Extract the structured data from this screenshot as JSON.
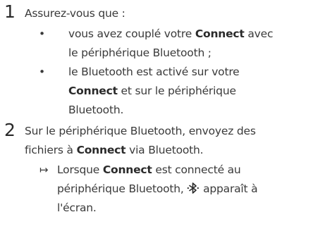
{
  "step1": {
    "number": "1",
    "intro": "Assurez-vous que :",
    "bullet_symbol": "•",
    "bullets": [
      {
        "line1_a": "vous avez couplé votre ",
        "line1_b": "Connect",
        "line1_c": " avec",
        "line2": "le périphérique Bluetooth ;"
      },
      {
        "line1": "le Bluetooth est activé sur votre",
        "line2_a": "Connect",
        "line2_b": " et sur le périphérique",
        "line3": "Bluetooth."
      }
    ]
  },
  "step2": {
    "number": "2",
    "line1": "Sur le périphérique Bluetooth, envoyez des",
    "line2_a": "fichiers à ",
    "line2_b": "Connect",
    "line2_c": " via Bluetooth.",
    "result_symbol": "↦",
    "result": {
      "line1_a": "Lorsque ",
      "line1_b": "Connect",
      "line1_c": " est connecté au",
      "line2_a": "périphérique Bluetooth, ",
      "line2_b": " apparaît à",
      "line3": "l'écran."
    }
  },
  "icons": {
    "bluetooth_icon": "bluetooth-icon"
  }
}
